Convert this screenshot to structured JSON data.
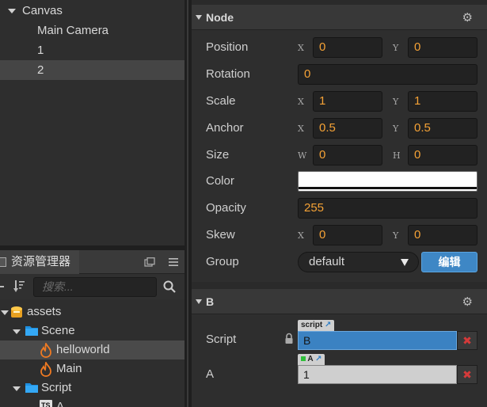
{
  "hierarchy": {
    "items": [
      {
        "label": "Canvas",
        "depth": 0,
        "expanded": true
      },
      {
        "label": "Main Camera",
        "depth": 1
      },
      {
        "label": "1",
        "depth": 1
      },
      {
        "label": "2",
        "depth": 1,
        "selected": true
      }
    ]
  },
  "assets_panel": {
    "title": "资源管理器",
    "search_placeholder": "搜索...",
    "tree": [
      {
        "label": "assets",
        "type": "db-icon"
      },
      {
        "label": "Scene",
        "type": "folder-icon"
      },
      {
        "label": "helloworld",
        "type": "fire-icon",
        "selected": true
      },
      {
        "label": "Main",
        "type": "fire-icon"
      },
      {
        "label": "Script",
        "type": "folder-icon"
      },
      {
        "label": "A",
        "type": "ts-icon"
      }
    ],
    "ts_badge": "TS"
  },
  "inspector": {
    "node": {
      "title": "Node",
      "position": {
        "label": "Position",
        "x": "0",
        "y": "0"
      },
      "rotation": {
        "label": "Rotation",
        "value": "0"
      },
      "scale": {
        "label": "Scale",
        "x": "1",
        "y": "1"
      },
      "anchor": {
        "label": "Anchor",
        "x": "0.5",
        "y": "0.5"
      },
      "size": {
        "label": "Size",
        "w": "0",
        "h": "0"
      },
      "color": {
        "label": "Color",
        "value_hex": "#ffffff"
      },
      "opacity": {
        "label": "Opacity",
        "value": "255"
      },
      "skew": {
        "label": "Skew",
        "x": "0",
        "y": "0"
      },
      "group": {
        "label": "Group",
        "value": "default",
        "edit_label": "编辑"
      },
      "axis": {
        "x": "X",
        "y": "Y",
        "w": "W",
        "h": "H"
      }
    },
    "component_b": {
      "title": "B",
      "script": {
        "label": "Script",
        "tag": "script",
        "value": "B"
      },
      "a": {
        "label": "A",
        "tag": "A",
        "value": "1"
      },
      "remove_symbol": "✖"
    }
  },
  "colors": {
    "accent_blue": "#3e87c5",
    "value_orange": "#f5a236",
    "remove_red": "#d63a3a"
  }
}
